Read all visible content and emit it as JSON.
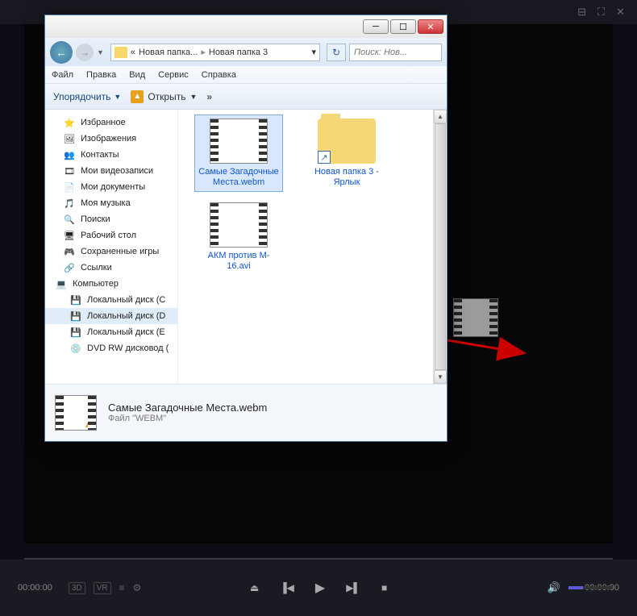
{
  "player": {
    "time_left": "00:00:00",
    "time_right": "00:00:00",
    "left_buttons": [
      "3D",
      "VR"
    ],
    "header_icons": [
      "⊞",
      "◫",
      "✕"
    ]
  },
  "explorer": {
    "breadcrumb": {
      "parent": "Новая папка...",
      "current": "Новая папка 3"
    },
    "search_placeholder": "Поиск: Нов...",
    "menu": [
      "Файл",
      "Правка",
      "Вид",
      "Сервис",
      "Справка"
    ],
    "toolbar": {
      "organize": "Упорядочить",
      "open": "Открыть",
      "more": "»"
    },
    "sidebar": [
      {
        "label": "Избранное",
        "icon": "⭐",
        "type": "fav"
      },
      {
        "label": "Изображения",
        "icon": "🖼",
        "type": "fav"
      },
      {
        "label": "Контакты",
        "icon": "👥",
        "type": "fav"
      },
      {
        "label": "Мои видеозаписи",
        "icon": "🎞",
        "type": "fav"
      },
      {
        "label": "Мои документы",
        "icon": "📄",
        "type": "fav"
      },
      {
        "label": "Моя музыка",
        "icon": "🎵",
        "type": "fav"
      },
      {
        "label": "Поиски",
        "icon": "🔍",
        "type": "fav"
      },
      {
        "label": "Рабочий стол",
        "icon": "🖥",
        "type": "fav"
      },
      {
        "label": "Сохраненные игры",
        "icon": "🎮",
        "type": "fav"
      },
      {
        "label": "Ссылки",
        "icon": "🔗",
        "type": "fav"
      },
      {
        "label": "Компьютер",
        "icon": "💻",
        "type": "comp"
      },
      {
        "label": "Локальный диск (C",
        "icon": "💾",
        "type": "disk"
      },
      {
        "label": "Локальный диск (D",
        "icon": "💾",
        "type": "disk",
        "sel": true
      },
      {
        "label": "Локальный диск (E",
        "icon": "💾",
        "type": "disk"
      },
      {
        "label": "DVD RW дисковод (",
        "icon": "💿",
        "type": "disk"
      }
    ],
    "files": [
      {
        "name": "АКМ против M-16.avi",
        "type": "video"
      },
      {
        "name": "Новая папка 3 - Ярлык",
        "type": "shortcut"
      },
      {
        "name": "Самые Загадочные Места.webm",
        "type": "video",
        "selected": true,
        "badge": true
      }
    ],
    "details": {
      "name": "Самые Загадочные Места.webm",
      "type": "Файл \"WEBM\""
    }
  }
}
